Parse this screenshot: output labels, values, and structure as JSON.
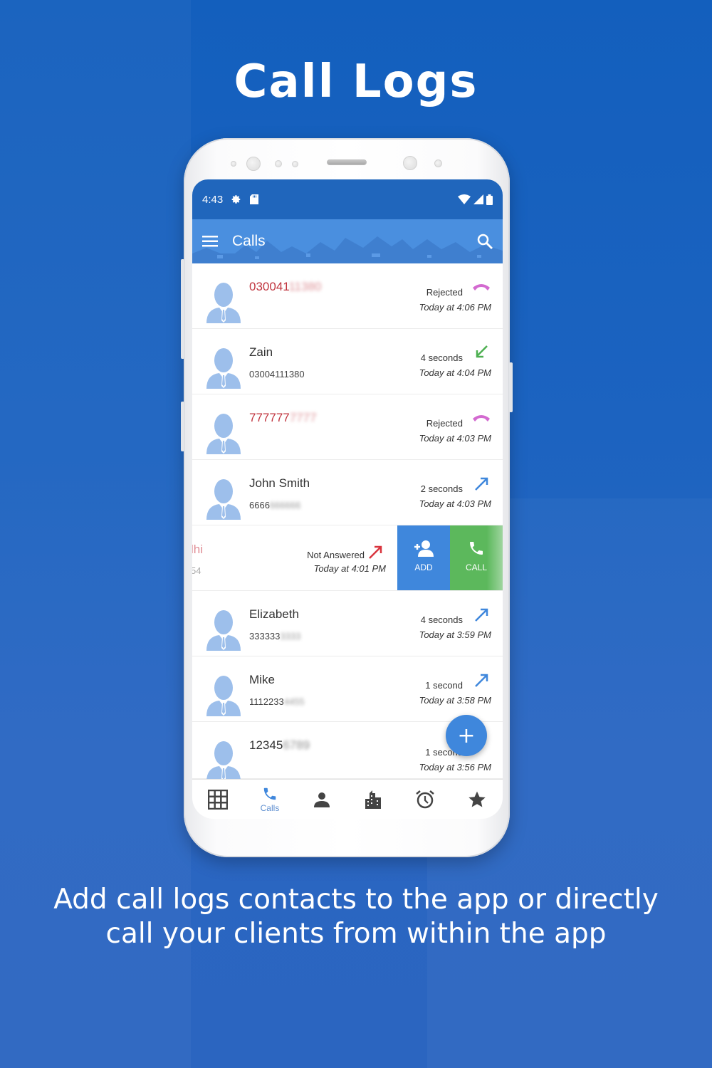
{
  "page": {
    "headline": "Call Logs",
    "subtitle_line1": "Add call logs contacts to the app or directly",
    "subtitle_line2": "call your clients from within the app",
    "colors": {
      "background": "#1a60be",
      "appbar": "#4a8fdf",
      "statusbar": "#2066bc",
      "accent": "#3f87dc",
      "call_green": "#5cb85c",
      "missed_red": "#c0343e",
      "rejected_pink": "#d36ad0",
      "incoming_green": "#4caf50",
      "outgoing_blue": "#3f87dc"
    }
  },
  "statusbar": {
    "time": "4:43",
    "icons": [
      "gear-icon",
      "sd-card-icon",
      "wifi-icon",
      "signal-icon",
      "battery-icon"
    ]
  },
  "appbar": {
    "menu_icon": "hamburger-menu-icon",
    "title": "Calls",
    "search_icon": "search-icon"
  },
  "calls": [
    {
      "name": "030041",
      "name_hidden": "11380",
      "number": "",
      "number_hidden": "",
      "red": true,
      "status": "Rejected",
      "time": "Today at 4:06 PM",
      "type": "rejected"
    },
    {
      "name": "Zain",
      "name_hidden": "",
      "number": "03004111380",
      "number_hidden": "",
      "red": false,
      "status": "4 seconds",
      "time": "Today at 4:04 PM",
      "type": "incoming"
    },
    {
      "name": "777777",
      "name_hidden": "7777",
      "number": "",
      "number_hidden": "",
      "red": true,
      "status": "Rejected",
      "time": "Today at 4:03 PM",
      "type": "rejected"
    },
    {
      "name": "John Smith",
      "name_hidden": "",
      "number": "6666",
      "number_hidden": "666666",
      "red": false,
      "status": "2 seconds",
      "time": "Today at 4:03 PM",
      "type": "outgoing"
    }
  ],
  "swiped_call": {
    "name_fragment": "lhi",
    "number_fragment": "54",
    "status": "Not Answered",
    "time": "Today at 4:01 PM",
    "type": "missed",
    "actions": [
      {
        "label": "ADD",
        "icon": "add-contact-icon"
      },
      {
        "label": "CALL",
        "icon": "phone-icon"
      }
    ]
  },
  "calls_after": [
    {
      "name": "Elizabeth",
      "name_hidden": "",
      "number": "333333",
      "number_hidden": "3333",
      "red": false,
      "status": "4 seconds",
      "time": "Today at 3:59 PM",
      "type": "outgoing"
    },
    {
      "name": "Mike",
      "name_hidden": "",
      "number": "1112233",
      "number_hidden": "4455",
      "red": false,
      "status": "1 second",
      "time": "Today at 3:58 PM",
      "type": "outgoing"
    },
    {
      "name": "12345",
      "name_hidden": "6789",
      "number": "",
      "number_hidden": "",
      "red": false,
      "status": "1 second",
      "time": "Today at 3:56 PM",
      "type": "outgoing"
    }
  ],
  "fab": {
    "label": "+",
    "icon": "add-icon"
  },
  "bottom_nav": [
    {
      "icon": "dialpad-icon",
      "label": "",
      "active": false
    },
    {
      "icon": "phone-icon",
      "label": "Calls",
      "active": true
    },
    {
      "icon": "person-icon",
      "label": "",
      "active": false
    },
    {
      "icon": "building-icon",
      "label": "",
      "active": false
    },
    {
      "icon": "alarm-clock-icon",
      "label": "",
      "active": false
    },
    {
      "icon": "star-icon",
      "label": "",
      "active": false
    }
  ]
}
